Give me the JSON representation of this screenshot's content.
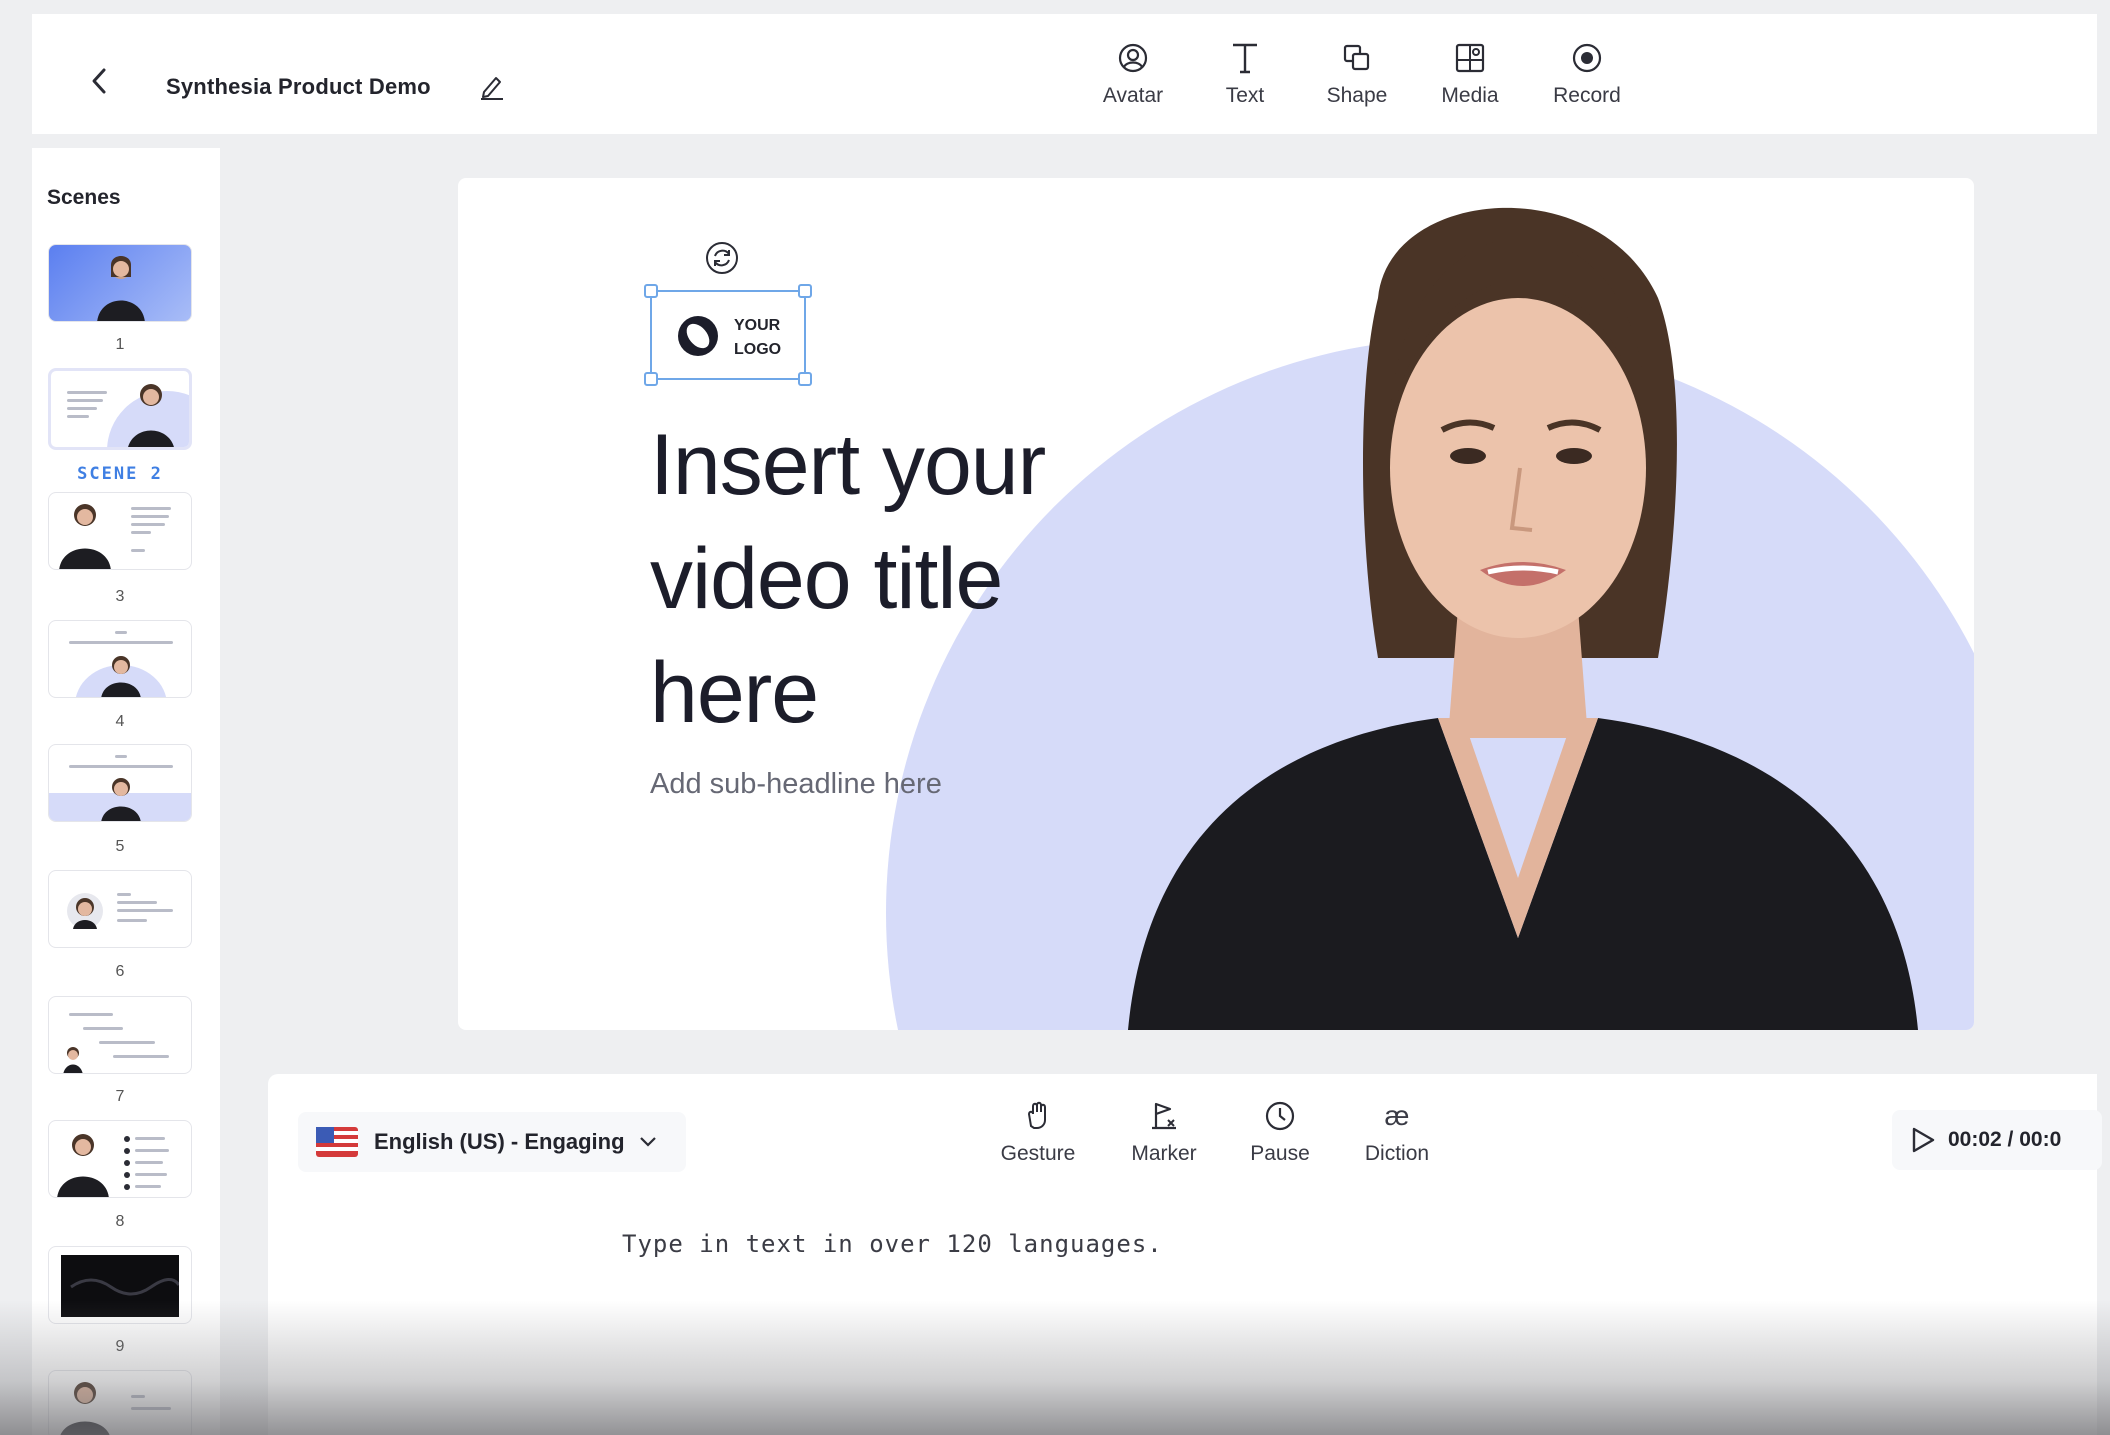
{
  "header": {
    "project_title": "Synthesia Product Demo",
    "tools": [
      {
        "label": "Avatar",
        "icon": "avatar-icon"
      },
      {
        "label": "Text",
        "icon": "text-icon"
      },
      {
        "label": "Shape",
        "icon": "shape-icon"
      },
      {
        "label": "Media",
        "icon": "media-icon"
      },
      {
        "label": "Record",
        "icon": "record-icon"
      }
    ]
  },
  "scenes": {
    "title": "Scenes",
    "items": [
      {
        "label": "1"
      },
      {
        "label": "SCENE 2",
        "selected": true
      },
      {
        "label": "3"
      },
      {
        "label": "4"
      },
      {
        "label": "5"
      },
      {
        "label": "6"
      },
      {
        "label": "7"
      },
      {
        "label": "8"
      },
      {
        "label": "9"
      }
    ]
  },
  "canvas": {
    "logo_line1": "YOUR",
    "logo_line2": "LOGO",
    "headline": "Insert your video title here",
    "subheadline": "Add sub-headline here"
  },
  "editor": {
    "language": "English (US) - Engaging",
    "tools": [
      {
        "label": "Gesture",
        "icon": "gesture-icon"
      },
      {
        "label": "Marker",
        "icon": "marker-icon"
      },
      {
        "label": "Pause",
        "icon": "pause-clock-icon"
      },
      {
        "label": "Diction",
        "icon": "diction-icon"
      }
    ],
    "time": "00:02 / 00:0",
    "script_text": "Type in text in over 120 languages."
  },
  "colors": {
    "accent": "#3f7fe3",
    "selection": "#6fa7e8",
    "background_circle": "#d6dbf9"
  }
}
